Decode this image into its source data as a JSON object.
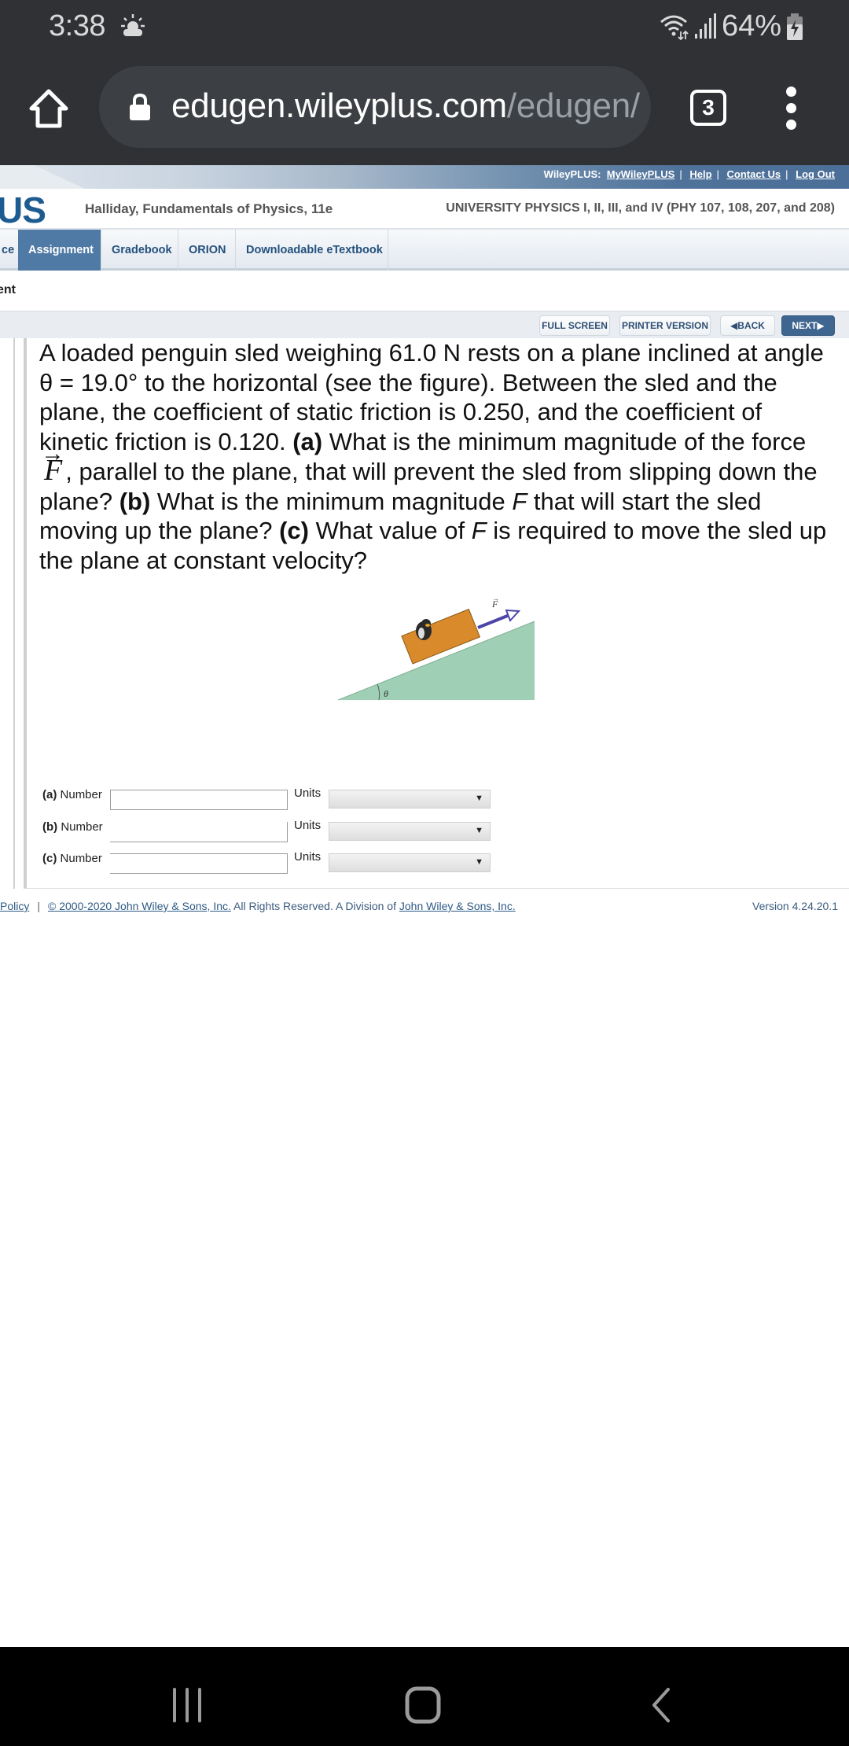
{
  "status_bar": {
    "time": "3:38",
    "weather_icon": "partly-sunny-icon",
    "battery_percent": "64%",
    "icons": [
      "wifi-icon",
      "signal-icon",
      "battery-charging-icon"
    ]
  },
  "browser": {
    "url_domain": "edugen.wileyplus.com",
    "url_path": "/edugen/",
    "tab_count": "3",
    "icons": [
      "home-icon",
      "lock-icon",
      "tabs-icon",
      "more-vert-icon"
    ]
  },
  "header": {
    "toplinks_prefix": "WileyPLUS:",
    "toplinks": [
      "MyWileyPLUS",
      "Help",
      "Contact Us",
      "Log Out"
    ],
    "logo_fragment": "US",
    "book_title": "Halliday, Fundamentals of Physics, 11e",
    "course_title": "UNIVERSITY PHYSICS I, II, III, and IV (PHY 107, 108, 207, and 208)"
  },
  "nav": {
    "tabs": [
      {
        "label": "ce",
        "active": false
      },
      {
        "label": "Assignment",
        "active": true
      },
      {
        "label": "Gradebook",
        "active": false
      },
      {
        "label": "ORION",
        "active": false
      },
      {
        "label": "Downloadable eTextbook",
        "active": false
      }
    ],
    "subheading": "ent"
  },
  "toolbar": {
    "full_screen": "FULL SCREEN",
    "printer_version": "PRINTER VERSION",
    "back": "BACK",
    "next": "NEXT"
  },
  "question": {
    "p1": "A loaded penguin sled weighing 61.0 N rests on a plane inclined at angle θ = 19.0° to the horizontal (see the figure). Between the sled and the plane, the coefficient of static friction is 0.250, and the coefficient of kinetic friction is 0.120. ",
    "a_label": "(a)",
    "p2": " What is the minimum magnitude of the force ",
    "vector_symbol": "F",
    "vector_arrow": "→",
    "p3": ", parallel to the plane, that will prevent the sled from slipping down the plane? ",
    "b_label": "(b)",
    "p4": " What is the minimum magnitude ",
    "f_italic_1": "F",
    "p5": " that will start the sled moving up the plane? ",
    "c_label": "(c)",
    "p6": " What value of ",
    "f_italic_2": "F",
    "p7": " is required to move the sled up the plane at constant velocity?"
  },
  "figure": {
    "force_label": "F",
    "angle_label": "θ",
    "colors": {
      "incline": "#9fd0b5",
      "sled": "#d98a2b",
      "force_arrow": "#4b46a8"
    }
  },
  "answers": [
    {
      "part": "(a)",
      "number_label": "Number",
      "value": "",
      "units_label": "Units",
      "units_value": ""
    },
    {
      "part": "(b)",
      "number_label": "Number",
      "value": "",
      "units_label": "Units",
      "units_value": ""
    },
    {
      "part": "(c)",
      "number_label": "Number",
      "value": "",
      "units_label": "Units",
      "units_value": ""
    }
  ],
  "footer": {
    "policy": "Policy",
    "copyright_link": "© 2000-2020 John Wiley & Sons, Inc.",
    "rights_text": " All Rights Reserved. A Division of ",
    "division_link": "John Wiley & Sons, Inc.",
    "version": "Version 4.24.20.1"
  },
  "android_nav": {
    "icons": [
      "recents-icon",
      "home-icon",
      "back-icon"
    ]
  },
  "colors": {
    "chrome_bg": "#2f3135",
    "wiley_blue": "#4f7aa5",
    "link_blue": "#23507d",
    "next_button": "#3f6690"
  }
}
